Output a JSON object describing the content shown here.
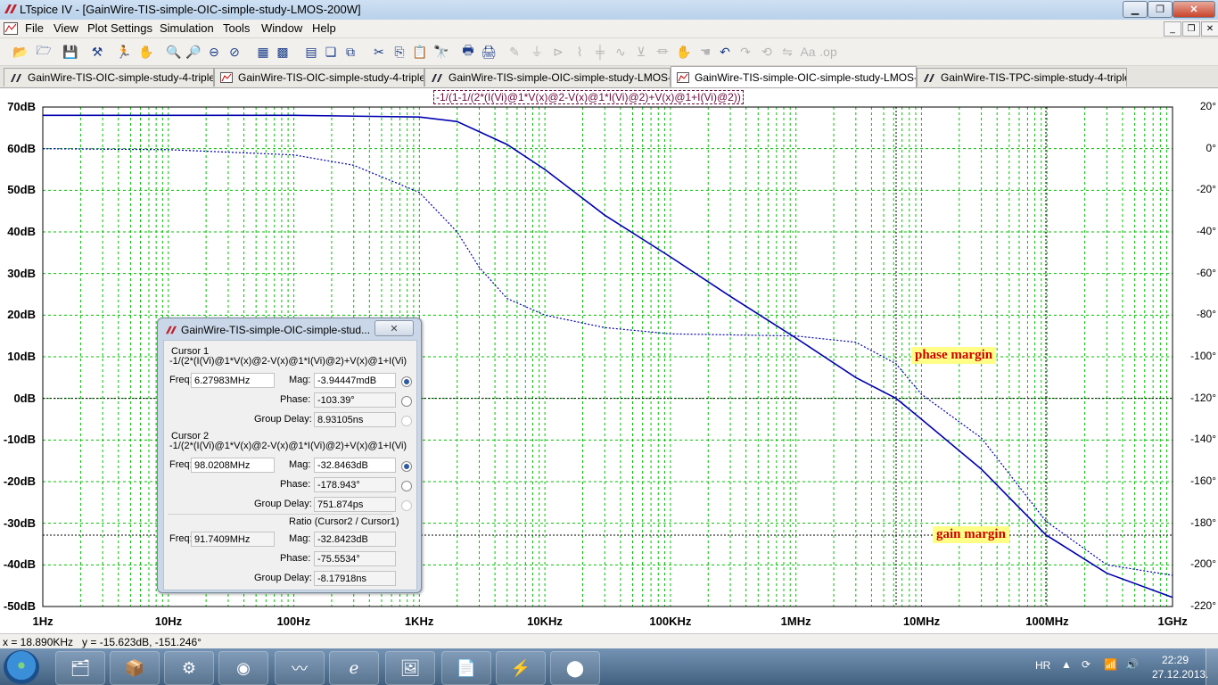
{
  "window": {
    "title": "LTspice IV - [GainWire-TIS-simple-OIC-simple-study-LMOS-200W]",
    "minimize": "▁",
    "maximize": "❐",
    "close": "✕"
  },
  "menu": {
    "items": [
      "File",
      "View",
      "Plot Settings",
      "Simulation",
      "Tools",
      "Window",
      "Help"
    ]
  },
  "tabs": [
    {
      "label": "GainWire-TIS-OIC-simple-study-4-tripleOPS",
      "icon": "schematic-icon"
    },
    {
      "label": "GainWire-TIS-OIC-simple-study-4-tripleOPS",
      "icon": "waveform-icon"
    },
    {
      "label": "GainWire-TIS-simple-OIC-simple-study-LMOS-200W",
      "icon": "schematic-icon"
    },
    {
      "label": "GainWire-TIS-simple-OIC-simple-study-LMOS-200W",
      "icon": "waveform-icon",
      "active": true
    },
    {
      "label": "GainWire-TIS-TPC-simple-study-4-tripleOPS",
      "icon": "schematic-icon"
    }
  ],
  "plot": {
    "expression": "-1/(1-1/(2*(I(Vi)@1*V(x)@2-V(x)@1*I(Vi)@2)+V(x)@1+I(Vi)@2))",
    "y_left_ticks": [
      "70dB",
      "60dB",
      "50dB",
      "40dB",
      "30dB",
      "20dB",
      "10dB",
      "0dB",
      "-10dB",
      "-20dB",
      "-30dB",
      "-40dB",
      "-50dB"
    ],
    "y_right_ticks": [
      "20°",
      "0°",
      "-20°",
      "-40°",
      "-60°",
      "-80°",
      "-100°",
      "-120°",
      "-140°",
      "-160°",
      "-180°",
      "-200°",
      "-220°"
    ],
    "x_ticks": [
      "1Hz",
      "10Hz",
      "100Hz",
      "1KHz",
      "10KHz",
      "100KHz",
      "1MHz",
      "10MHz",
      "100MHz",
      "1GHz"
    ],
    "annotations": {
      "phase_margin": "phase margin",
      "gain_margin": "gain margin"
    },
    "colors": {
      "trace": "#0000b0",
      "grid": "#00c000",
      "background": "#ffffff"
    }
  },
  "chart_data": {
    "type": "line",
    "title": "-1/(1-1/(2*(I(Vi)@1*V(x)@2-V(x)@1*I(Vi)@2)+V(x)@1+I(Vi)@2))",
    "x_scale": "log",
    "xlim_hz": [
      1,
      1000000000
    ],
    "ylim_db": [
      -50,
      70
    ],
    "ylim_phase_deg": [
      -220,
      20
    ],
    "series": [
      {
        "name": "",
        "style": "solid",
        "axis": "magnitude_dB",
        "x": [
          1,
          10,
          100,
          1000,
          2000,
          5000,
          10000,
          30000,
          100000,
          300000,
          1000000,
          3000000,
          6280000,
          10000000,
          30000000,
          98000000,
          300000000,
          1000000000
        ],
        "y": [
          68,
          68,
          68,
          67.6,
          66.5,
          61,
          55,
          44,
          34,
          24.5,
          14.5,
          5,
          0,
          -5,
          -17,
          -32.8,
          -42,
          -47.8
        ]
      },
      {
        "name": "",
        "style": "dotted",
        "axis": "phase_deg",
        "x": [
          1,
          10,
          100,
          300,
          1000,
          2000,
          3000,
          5000,
          10000,
          30000,
          100000,
          1000000,
          3000000,
          6280000,
          10000000,
          30000000,
          98000000,
          300000000,
          1000000000
        ],
        "y": [
          0,
          -0.5,
          -3,
          -8,
          -21,
          -40,
          -57,
          -72,
          -80,
          -86,
          -89,
          -90,
          -93,
          -103.4,
          -118,
          -139,
          -179,
          -200,
          -205
        ]
      }
    ]
  },
  "cursor_dialog": {
    "title": "GainWire-TIS-simple-OIC-simple-stud...",
    "close": "✕",
    "cursor1": {
      "heading": "Cursor 1",
      "expr": "-1/(2*(I(Vi)@1*V(x)@2-V(x)@1*I(Vi)@2)+V(x)@1+I(Vi)",
      "freq_label": "Freq:",
      "freq": "6.27983MHz",
      "mag_label": "Mag:",
      "mag": "-3.94447mdB",
      "phase_label": "Phase:",
      "phase": "-103.39°",
      "gd_label": "Group Delay:",
      "gd": "8.93105ns"
    },
    "cursor2": {
      "heading": "Cursor 2",
      "expr": "-1/(2*(I(Vi)@1*V(x)@2-V(x)@1*I(Vi)@2)+V(x)@1+I(Vi)",
      "freq_label": "Freq:",
      "freq": "98.0208MHz",
      "mag_label": "Mag:",
      "mag": "-32.8463dB",
      "phase_label": "Phase:",
      "phase": "-178.943°",
      "gd_label": "Group Delay:",
      "gd": "751.874ps"
    },
    "ratio": {
      "heading": "Ratio (Cursor2 / Cursor1)",
      "freq_label": "Freq:",
      "freq": "91.7409MHz",
      "mag_label": "Mag:",
      "mag": "-32.8423dB",
      "phase_label": "Phase:",
      "phase": "-75.5534°",
      "gd_label": "Group Delay:",
      "gd": "-8.17918ns"
    }
  },
  "status": {
    "text": "x = 18.890KHz   y = -15.623dB, -151.246°"
  },
  "taskbar": {
    "lang": "HR",
    "time": "22:29",
    "date": "27.12.2013."
  }
}
